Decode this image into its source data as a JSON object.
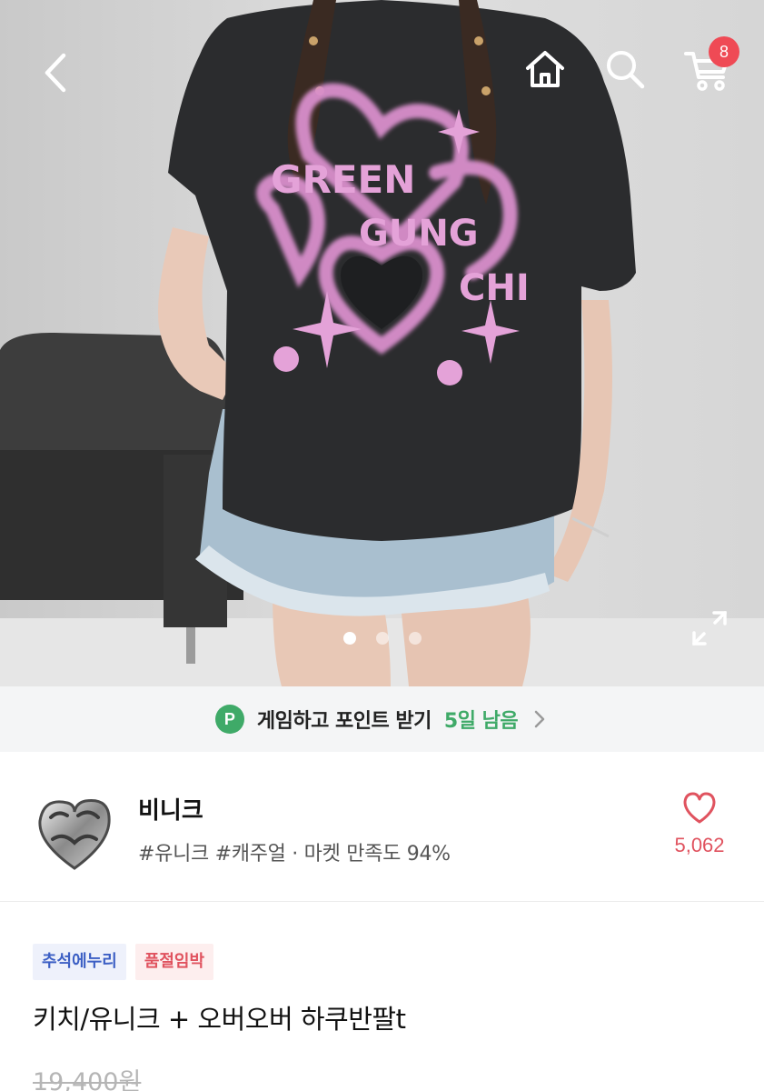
{
  "header": {
    "icons": [
      "back-arrow-icon",
      "home-icon",
      "search-icon",
      "cart-icon"
    ],
    "cart_count": "8"
  },
  "gallery": {
    "image_count": 3,
    "active_index": 0,
    "print_text": [
      "GREEN",
      "GUNG",
      "CHI"
    ],
    "expand_icon": "expand-icon"
  },
  "game_banner": {
    "icon_label": "P",
    "text": "게임하고 포인트 받기",
    "days_left": "5일 남음"
  },
  "shop": {
    "name": "비니크",
    "tags": "#유니크 #캐주얼 · 마켓 만족도 94%",
    "likes": "5,062"
  },
  "product": {
    "badges": [
      "추석에누리",
      "품절임박"
    ],
    "title": "키치/유니크 + 오버오버 하쿠반팔t",
    "original_price": "19,400원"
  },
  "colors": {
    "accent_green": "#3faa68",
    "badge_red": "#ef4a55",
    "like_pink": "#e0535f",
    "badge_blue": "#3c5fc4"
  }
}
